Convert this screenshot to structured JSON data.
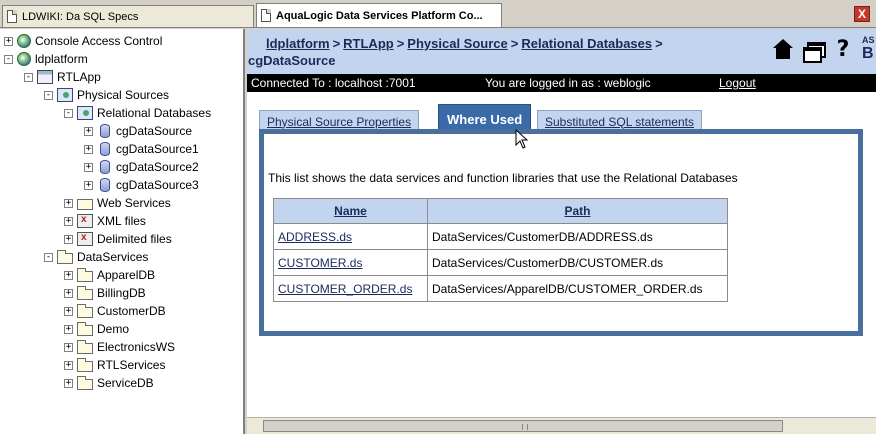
{
  "browser": {
    "tabs": [
      {
        "label": "LDWIKI: Da SQL Specs"
      },
      {
        "label": "AquaLogic Data Services Platform Co..."
      }
    ],
    "close_label": "X"
  },
  "tree": {
    "items": [
      {
        "label": "Console Access Control",
        "toggle": "+"
      },
      {
        "label": "ldplatform",
        "toggle": "-"
      },
      {
        "label": "RTLApp",
        "toggle": "-"
      },
      {
        "label": "Physical Sources",
        "toggle": "-"
      },
      {
        "label": "Relational Databases",
        "toggle": "-"
      },
      {
        "label": "cgDataSource",
        "toggle": "+"
      },
      {
        "label": "cgDataSource1",
        "toggle": "+"
      },
      {
        "label": "cgDataSource2",
        "toggle": "+"
      },
      {
        "label": "cgDataSource3",
        "toggle": "+"
      },
      {
        "label": "Web Services",
        "toggle": "+"
      },
      {
        "label": "XML files",
        "toggle": "+"
      },
      {
        "label": "Delimited files",
        "toggle": "+"
      },
      {
        "label": "DataServices",
        "toggle": "-"
      },
      {
        "label": "ApparelDB",
        "toggle": "+"
      },
      {
        "label": "BillingDB",
        "toggle": "+"
      },
      {
        "label": "CustomerDB",
        "toggle": "+"
      },
      {
        "label": "Demo",
        "toggle": "+"
      },
      {
        "label": "ElectronicsWS",
        "toggle": "+"
      },
      {
        "label": "RTLServices",
        "toggle": "+"
      },
      {
        "label": "ServiceDB",
        "toggle": "+"
      }
    ]
  },
  "header": {
    "breadcrumbs": [
      "ldplatform",
      "RTLApp",
      "Physical Source",
      "Relational Databases"
    ],
    "separator": ">",
    "current": "cgDataSource",
    "logo_text_top": "AS",
    "logo_text_big": "B",
    "help_label": "?"
  },
  "status": {
    "connected": "Connected To :  localhost :7001",
    "user": "You are logged in as :  weblogic",
    "logout": "Logout"
  },
  "tabs": [
    {
      "label": "Physical Source Properties"
    },
    {
      "label": "Where Used"
    },
    {
      "label": "Substituted SQL statements"
    }
  ],
  "panel": {
    "description": "This list shows the data services and function libraries that use the Relational Databases",
    "columns": [
      "Name",
      "Path"
    ],
    "rows": [
      {
        "name": "ADDRESS.ds",
        "path": "DataServices/CustomerDB/ADDRESS.ds"
      },
      {
        "name": "CUSTOMER.ds",
        "path": "DataServices/CustomerDB/CUSTOMER.ds"
      },
      {
        "name": "CUSTOMER_ORDER.ds",
        "path": "DataServices/ApparelDB/CUSTOMER_ORDER.ds"
      }
    ]
  },
  "colors": {
    "header_bg": "#c3d5ee",
    "selected_tab": "#3a6aa8",
    "panel_border": "#4a6f9c",
    "status_bg": "#000000"
  }
}
